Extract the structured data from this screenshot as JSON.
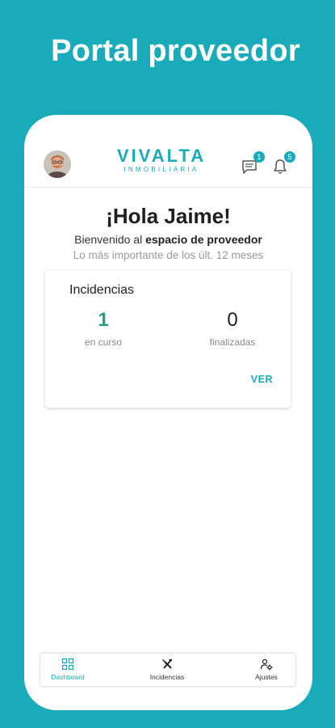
{
  "promo": {
    "title": "Portal proveedor"
  },
  "header": {
    "logo_main": "VIVALTA",
    "logo_sub": "INMOBILIARIA",
    "messages_badge": "1",
    "notifications_badge": "5"
  },
  "greeting": {
    "title": "¡Hola Jaime!",
    "welcome_prefix": "Bienvenido al ",
    "welcome_bold": "espacio de proveedor",
    "subtitle": "Lo más importante de los últ. 12 meses"
  },
  "incidencias_card": {
    "title": "Incidencias",
    "in_progress_count": "1",
    "in_progress_label": "en curso",
    "finished_count": "0",
    "finished_label": "finalizadas",
    "link": "VER"
  },
  "bottom_nav": {
    "items": [
      {
        "label": "Dashboard",
        "icon": "dashboard-icon",
        "active": true
      },
      {
        "label": "Incidencias",
        "icon": "tools-icon",
        "active": false
      },
      {
        "label": "Ajustes",
        "icon": "settings-icon",
        "active": false
      }
    ]
  },
  "colors": {
    "accent": "#1aabba",
    "count_green": "#2a9a83"
  }
}
